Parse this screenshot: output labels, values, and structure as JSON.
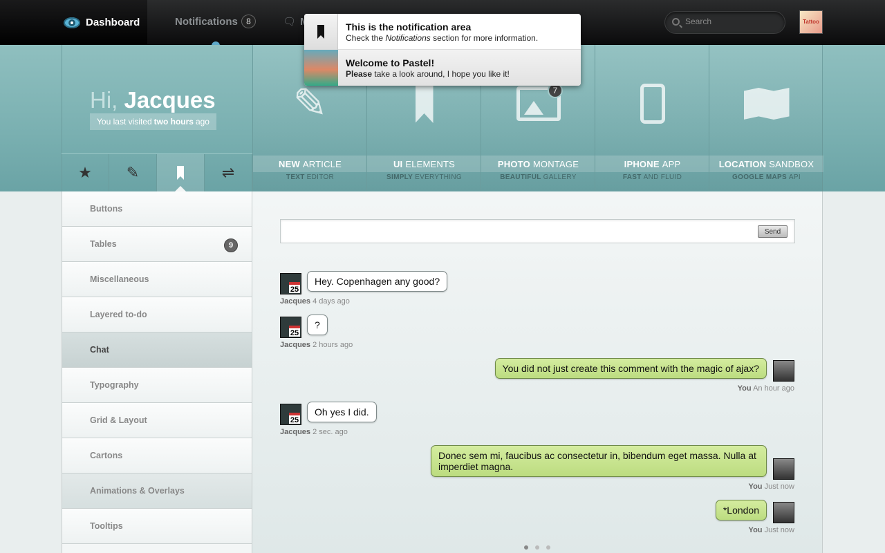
{
  "topnav": {
    "dashboard_label": "Dashboard",
    "notifications_label": "Notifications",
    "notifications_count": "8",
    "messages_label": "M",
    "search_placeholder": "Search",
    "avatar_text": "Tattoo"
  },
  "notification_popup": {
    "items": [
      {
        "title": "This is the notification area",
        "desc_pre": "Check the ",
        "desc_em": "Notifications",
        "desc_post": " section for more information."
      },
      {
        "title": "Welcome to Pastel!",
        "desc_bold": "Please",
        "desc_post": " take a look around, I hope you like it!"
      }
    ]
  },
  "greeting": {
    "hi": "Hi,",
    "name": "Jacques",
    "visited_pre": "You last visited",
    "visited_bold": "two hours",
    "visited_post": "ago"
  },
  "tiles": [
    {
      "title_bold": "NEW",
      "title": "ARTICLE",
      "sub_bold": "TEXT",
      "sub": "EDITOR",
      "icon": "edit-icon"
    },
    {
      "title_bold": "UI",
      "title": "ELEMENTS",
      "sub_bold": "SIMPLY",
      "sub": "EVERYTHING",
      "icon": "bookmark-icon"
    },
    {
      "title_bold": "PHOTO",
      "title": "MONTAGE",
      "sub_bold": "BEAUTIFUL",
      "sub": "GALLERY",
      "icon": "image-icon",
      "badge": "7"
    },
    {
      "title_bold": "IPHONE",
      "title": "APP",
      "sub_bold": "FAST",
      "sub": "AND FLUID",
      "icon": "phone-icon"
    },
    {
      "title_bold": "LOCATION",
      "title": "SANDBOX",
      "sub_bold": "GOOGLE MAPS",
      "sub": "API",
      "icon": "map-icon"
    }
  ],
  "iconbar": [
    "star-icon",
    "pencil-icon",
    "bookmark-icon",
    "shuffle-icon"
  ],
  "sidebar": {
    "items": [
      {
        "label": "Buttons"
      },
      {
        "label": "Tables",
        "badge": "9"
      },
      {
        "label": "Miscellaneous"
      },
      {
        "label": "Layered to-do"
      },
      {
        "label": "Chat"
      },
      {
        "label": "Typography"
      },
      {
        "label": "Grid & Layout"
      },
      {
        "label": "Cartons"
      },
      {
        "label": "Animations & Overlays"
      },
      {
        "label": "Tooltips"
      }
    ]
  },
  "chat": {
    "send_label": "Send",
    "messages": [
      {
        "text": "Hey. Copenhagen any good?",
        "author": "Jacques",
        "time": "4 days ago",
        "me": false,
        "cal": "25"
      },
      {
        "text": "?",
        "author": "Jacques",
        "time": "2 hours ago",
        "me": false,
        "cal": "25"
      },
      {
        "text": "You did not just create this comment with the magic of ajax?",
        "author": "You",
        "time": "An hour ago",
        "me": true
      },
      {
        "text": "Oh yes I did.",
        "author": "Jacques",
        "time": "2 sec. ago",
        "me": false,
        "cal": "25"
      },
      {
        "text": "Donec sem mi, faucibus ac consectetur in, bibendum eget massa. Nulla at imperdiet magna.",
        "author": "You",
        "time": "Just now",
        "me": true
      },
      {
        "text": "*London",
        "author": "You",
        "time": "Just now",
        "me": true
      }
    ]
  },
  "pager": {
    "pages": 3,
    "current": 1
  }
}
